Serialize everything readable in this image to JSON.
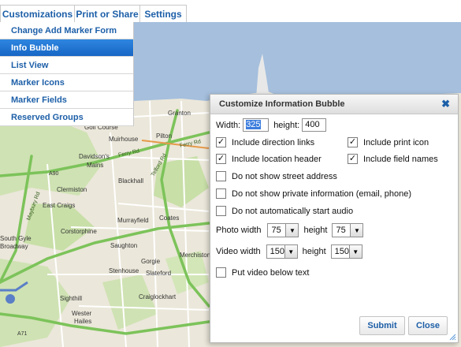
{
  "tabs": [
    {
      "label": "Customizations"
    },
    {
      "label": "Print or Share"
    },
    {
      "label": "Settings"
    }
  ],
  "menu": {
    "items": [
      {
        "label": "Change Add Marker Form"
      },
      {
        "label": "Info Bubble",
        "active": true
      },
      {
        "label": "List View"
      },
      {
        "label": "Marker Icons"
      },
      {
        "label": "Marker Fields"
      },
      {
        "label": "Reserved Groups"
      }
    ]
  },
  "map": {
    "places": [
      "Granton",
      "Golf Course",
      "Muirhouse",
      "Pilton",
      "Ferry Rd",
      "Ferry Rd",
      "Davidson's",
      "Mains",
      "Telford Rd",
      "A90",
      "Blackhall",
      "Maybury Rd",
      "Clermiston",
      "East Craigs",
      "Coates",
      "Corstorphine",
      "Murrayfield",
      "South Gyle",
      "Broadway",
      "Saughton",
      "Merchiston",
      "Gorgie",
      "Stenhouse",
      "Slateford",
      "Craiglockhart",
      "Sighthill",
      "Wester",
      "Hailes",
      "A71"
    ],
    "colors": {
      "land": "#ebe7da",
      "water": "#a5bfdd",
      "park": "#c8dfa8",
      "road_major": "#7cc35a",
      "road_minor": "#ffffff"
    }
  },
  "dialog": {
    "title": "Customize Information Bubble",
    "width_label": "Width:",
    "width_value": "325",
    "height_label": "height:",
    "height_value": "400",
    "options": [
      {
        "label": "Include direction links",
        "checked": true
      },
      {
        "label": "Include print icon",
        "checked": true
      },
      {
        "label": "Include location header",
        "checked": true
      },
      {
        "label": "Include field names",
        "checked": true
      },
      {
        "label": "Do not show street address",
        "checked": false
      },
      {
        "label": "Do not show private information (email, phone)",
        "checked": false
      },
      {
        "label": "Do not automatically start audio",
        "checked": false
      }
    ],
    "photo": {
      "label": "Photo width",
      "width": "75",
      "height_label": "height",
      "height": "75"
    },
    "video": {
      "label": "Video width",
      "width": "150",
      "height_label": "height",
      "height": "150"
    },
    "video_below": {
      "label": "Put video below text",
      "checked": false
    },
    "submit_label": "Submit",
    "close_label": "Close",
    "close_icon": "close-x-icon"
  }
}
